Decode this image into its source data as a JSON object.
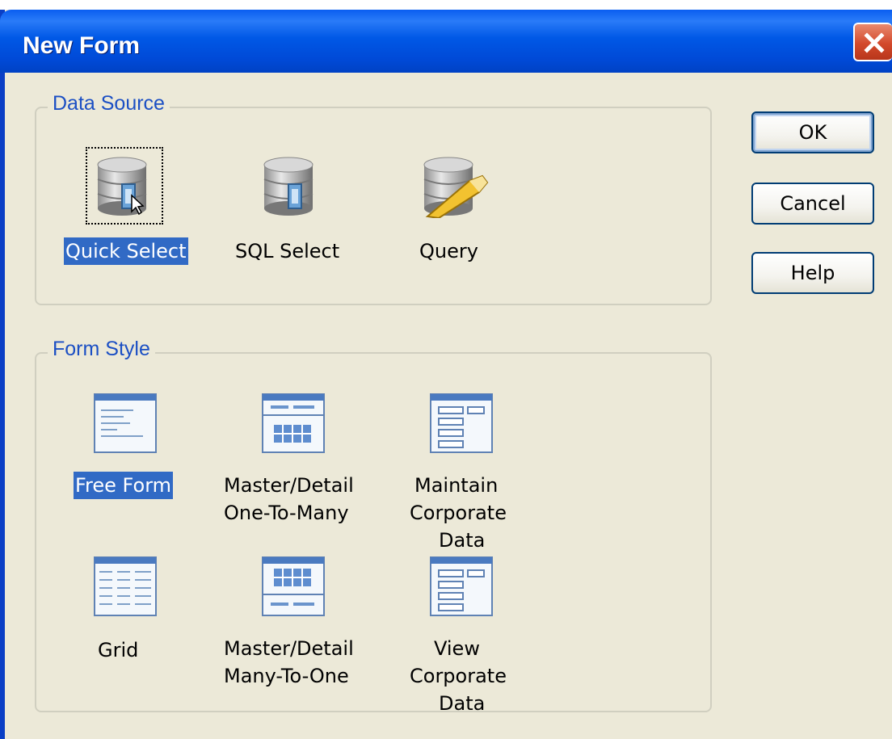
{
  "window": {
    "title": "New Form"
  },
  "data_source": {
    "legend": "Data Source",
    "items": [
      {
        "label": "Quick Select",
        "icon": "database-quick-select-icon",
        "selected": true
      },
      {
        "label": "SQL Select",
        "icon": "database-sql-icon",
        "selected": false
      },
      {
        "label": "Query",
        "icon": "database-query-icon",
        "selected": false
      }
    ]
  },
  "form_style": {
    "legend": "Form Style",
    "items": [
      {
        "label": "Free Form",
        "icon": "free-form-icon",
        "selected": true
      },
      {
        "label": "Master/Detail\nOne-To-Many",
        "line1": "Master/Detail",
        "line2": "One-To-Many",
        "icon": "master-detail-one-to-many-icon"
      },
      {
        "label": "Maintain Corporate Data",
        "line1": "Maintain",
        "line2": "Corporate",
        "line3": "Data",
        "icon": "maintain-corporate-data-icon"
      },
      {
        "label": "Grid",
        "icon": "grid-icon"
      },
      {
        "label": "Master/Detail Many-To-One",
        "line1": "Master/Detail",
        "line2": "Many-To-One",
        "icon": "master-detail-many-to-one-icon"
      },
      {
        "label": "View Corporate Data",
        "line1": "View",
        "line2": "Corporate",
        "line3": "Data",
        "icon": "view-corporate-data-icon"
      }
    ]
  },
  "buttons": {
    "ok": "OK",
    "cancel": "Cancel",
    "help": "Help"
  },
  "colors": {
    "selection": "#316AC5",
    "titlebar": "#0058E6",
    "dialog_bg": "#ECE9D8",
    "legend_text": "#1B4FC4"
  }
}
